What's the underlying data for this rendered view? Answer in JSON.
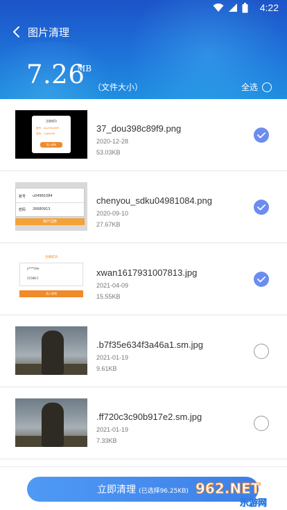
{
  "status_bar": {
    "time": "4:22"
  },
  "header": {
    "title": "图片清理",
    "total_size": "7.26",
    "size_unit": "MB",
    "size_label": "（文件大小）",
    "select_all_label": "全选"
  },
  "files": [
    {
      "name": "37_dou398c89f9.png",
      "date": "2020-12-28",
      "size": "53.03KB",
      "checked": true
    },
    {
      "name": "chenyou_sdku04981084.png",
      "date": "2020-09-10",
      "size": "27.67KB",
      "checked": true
    },
    {
      "name": "xwan1617931007813.jpg",
      "date": "2021-04-09",
      "size": "15.55KB",
      "checked": true
    },
    {
      "name": ".b7f35e634f3a46a1.sm.jpg",
      "date": "2021-01-19",
      "size": "9.61KB",
      "checked": false
    },
    {
      "name": ".ff720c3c90b917e2.sm.jpg",
      "date": "2021-01-19",
      "size": "7.33KB",
      "checked": false
    }
  ],
  "bottom": {
    "clean_label": "立即清理",
    "selected_info": "(已选择96.25KB)"
  },
  "thumb1": {
    "title": "注册成功",
    "line1": "账号：dou398c89f9",
    "line2": "密码：14d0b46f",
    "button": "进入游戏"
  },
  "thumb2": {
    "account_label": "账号",
    "account_value": "u04981084",
    "password_label": "密码",
    "password_value": "26680913",
    "button": "用户注册"
  },
  "thumb3": {
    "title": "注册成功",
    "line1": "y****zhe",
    "line2": "11568.C",
    "button": "进入游戏"
  },
  "watermark": {
    "logo_text": "962.NET",
    "site_text": "乐游网"
  },
  "colors": {
    "header_top": "#1c53c8",
    "header_bottom": "#1f8fe0",
    "check_on": "#6c8df0",
    "button": "#4f9af5"
  }
}
